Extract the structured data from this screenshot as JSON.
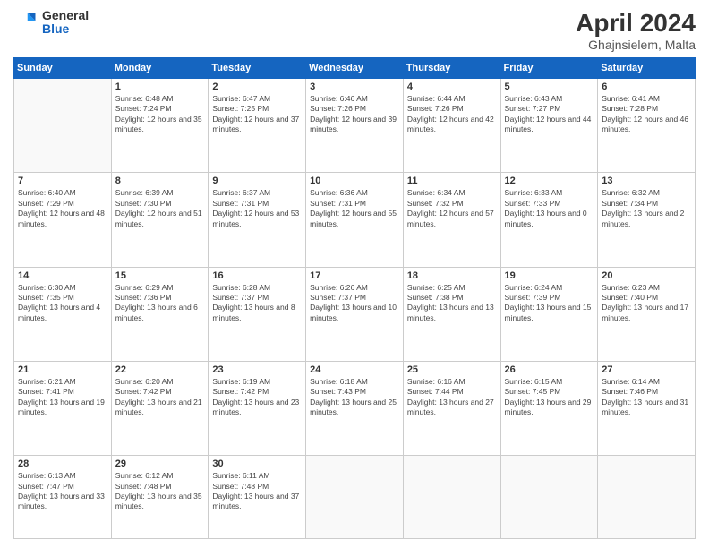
{
  "logo": {
    "general": "General",
    "blue": "Blue"
  },
  "title": {
    "month": "April 2024",
    "location": "Ghajnsielem, Malta"
  },
  "weekdays": [
    "Sunday",
    "Monday",
    "Tuesday",
    "Wednesday",
    "Thursday",
    "Friday",
    "Saturday"
  ],
  "weeks": [
    [
      {
        "day": "",
        "empty": true
      },
      {
        "day": "1",
        "sunrise": "6:48 AM",
        "sunset": "7:24 PM",
        "daylight": "12 hours and 35 minutes."
      },
      {
        "day": "2",
        "sunrise": "6:47 AM",
        "sunset": "7:25 PM",
        "daylight": "12 hours and 37 minutes."
      },
      {
        "day": "3",
        "sunrise": "6:46 AM",
        "sunset": "7:26 PM",
        "daylight": "12 hours and 39 minutes."
      },
      {
        "day": "4",
        "sunrise": "6:44 AM",
        "sunset": "7:26 PM",
        "daylight": "12 hours and 42 minutes."
      },
      {
        "day": "5",
        "sunrise": "6:43 AM",
        "sunset": "7:27 PM",
        "daylight": "12 hours and 44 minutes."
      },
      {
        "day": "6",
        "sunrise": "6:41 AM",
        "sunset": "7:28 PM",
        "daylight": "12 hours and 46 minutes."
      }
    ],
    [
      {
        "day": "7",
        "sunrise": "6:40 AM",
        "sunset": "7:29 PM",
        "daylight": "12 hours and 48 minutes."
      },
      {
        "day": "8",
        "sunrise": "6:39 AM",
        "sunset": "7:30 PM",
        "daylight": "12 hours and 51 minutes."
      },
      {
        "day": "9",
        "sunrise": "6:37 AM",
        "sunset": "7:31 PM",
        "daylight": "12 hours and 53 minutes."
      },
      {
        "day": "10",
        "sunrise": "6:36 AM",
        "sunset": "7:31 PM",
        "daylight": "12 hours and 55 minutes."
      },
      {
        "day": "11",
        "sunrise": "6:34 AM",
        "sunset": "7:32 PM",
        "daylight": "12 hours and 57 minutes."
      },
      {
        "day": "12",
        "sunrise": "6:33 AM",
        "sunset": "7:33 PM",
        "daylight": "13 hours and 0 minutes."
      },
      {
        "day": "13",
        "sunrise": "6:32 AM",
        "sunset": "7:34 PM",
        "daylight": "13 hours and 2 minutes."
      }
    ],
    [
      {
        "day": "14",
        "sunrise": "6:30 AM",
        "sunset": "7:35 PM",
        "daylight": "13 hours and 4 minutes."
      },
      {
        "day": "15",
        "sunrise": "6:29 AM",
        "sunset": "7:36 PM",
        "daylight": "13 hours and 6 minutes."
      },
      {
        "day": "16",
        "sunrise": "6:28 AM",
        "sunset": "7:37 PM",
        "daylight": "13 hours and 8 minutes."
      },
      {
        "day": "17",
        "sunrise": "6:26 AM",
        "sunset": "7:37 PM",
        "daylight": "13 hours and 10 minutes."
      },
      {
        "day": "18",
        "sunrise": "6:25 AM",
        "sunset": "7:38 PM",
        "daylight": "13 hours and 13 minutes."
      },
      {
        "day": "19",
        "sunrise": "6:24 AM",
        "sunset": "7:39 PM",
        "daylight": "13 hours and 15 minutes."
      },
      {
        "day": "20",
        "sunrise": "6:23 AM",
        "sunset": "7:40 PM",
        "daylight": "13 hours and 17 minutes."
      }
    ],
    [
      {
        "day": "21",
        "sunrise": "6:21 AM",
        "sunset": "7:41 PM",
        "daylight": "13 hours and 19 minutes."
      },
      {
        "day": "22",
        "sunrise": "6:20 AM",
        "sunset": "7:42 PM",
        "daylight": "13 hours and 21 minutes."
      },
      {
        "day": "23",
        "sunrise": "6:19 AM",
        "sunset": "7:42 PM",
        "daylight": "13 hours and 23 minutes."
      },
      {
        "day": "24",
        "sunrise": "6:18 AM",
        "sunset": "7:43 PM",
        "daylight": "13 hours and 25 minutes."
      },
      {
        "day": "25",
        "sunrise": "6:16 AM",
        "sunset": "7:44 PM",
        "daylight": "13 hours and 27 minutes."
      },
      {
        "day": "26",
        "sunrise": "6:15 AM",
        "sunset": "7:45 PM",
        "daylight": "13 hours and 29 minutes."
      },
      {
        "day": "27",
        "sunrise": "6:14 AM",
        "sunset": "7:46 PM",
        "daylight": "13 hours and 31 minutes."
      }
    ],
    [
      {
        "day": "28",
        "sunrise": "6:13 AM",
        "sunset": "7:47 PM",
        "daylight": "13 hours and 33 minutes."
      },
      {
        "day": "29",
        "sunrise": "6:12 AM",
        "sunset": "7:48 PM",
        "daylight": "13 hours and 35 minutes."
      },
      {
        "day": "30",
        "sunrise": "6:11 AM",
        "sunset": "7:48 PM",
        "daylight": "13 hours and 37 minutes."
      },
      {
        "day": "",
        "empty": true
      },
      {
        "day": "",
        "empty": true
      },
      {
        "day": "",
        "empty": true
      },
      {
        "day": "",
        "empty": true
      }
    ]
  ]
}
